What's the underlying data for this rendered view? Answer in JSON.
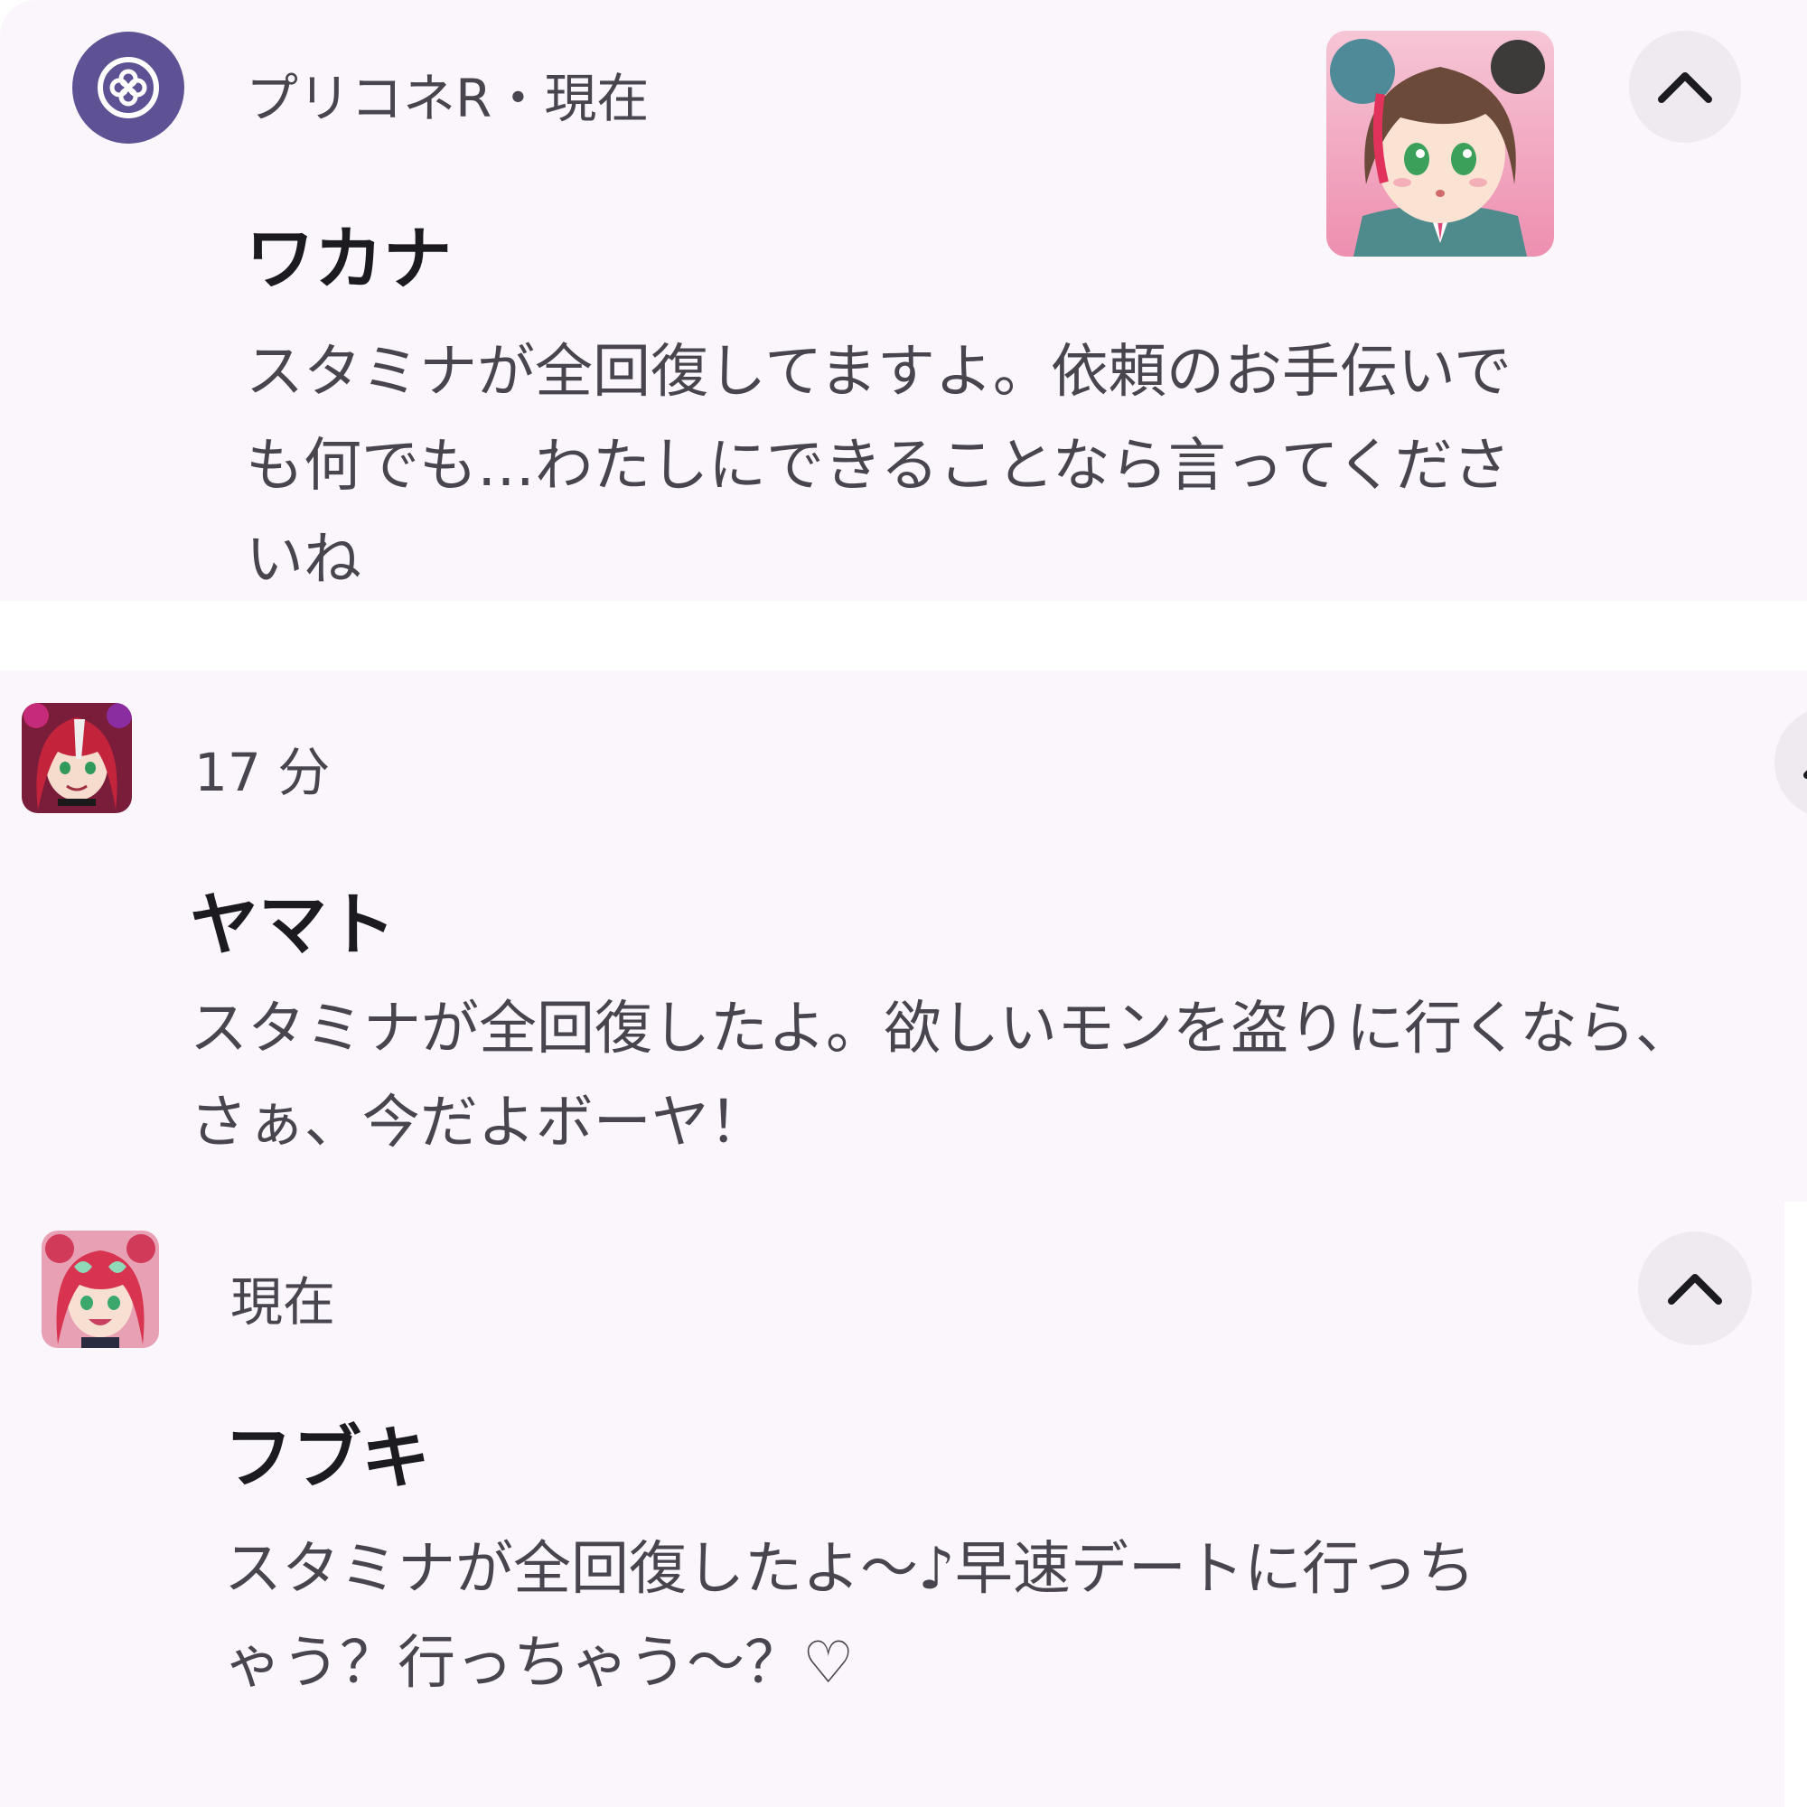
{
  "notifications": [
    {
      "app_name": "プリコネR",
      "separator": "・",
      "time": "現在",
      "title": "ワカナ",
      "body_lines": [
        "スタミナが全回復してますよ。依頼のお手伝いで",
        "も何でも…わたしにできることなら言ってくださ",
        "いね"
      ],
      "icon": "clover-app-icon",
      "expand_icon": "chevron-up-icon"
    },
    {
      "time": "17 分",
      "title": "ヤマト",
      "body_lines": [
        "スタミナが全回復したよ。欲しいモンを盗りに行くなら、",
        "さぁ、今だよボーヤ！"
      ],
      "expand_icon": "chevron-up-icon"
    },
    {
      "time": "現在",
      "title": "フブキ",
      "body_lines": [
        "スタミナが全回復したよ～♪早速デートに行っち",
        "ゃう？行っちゃう～？♡"
      ],
      "expand_icon": "chevron-up-icon"
    }
  ],
  "colors": {
    "card_background": "#fbf6fb",
    "app_icon_background": "#5e5294",
    "expand_button_background": "#efe9f0"
  }
}
